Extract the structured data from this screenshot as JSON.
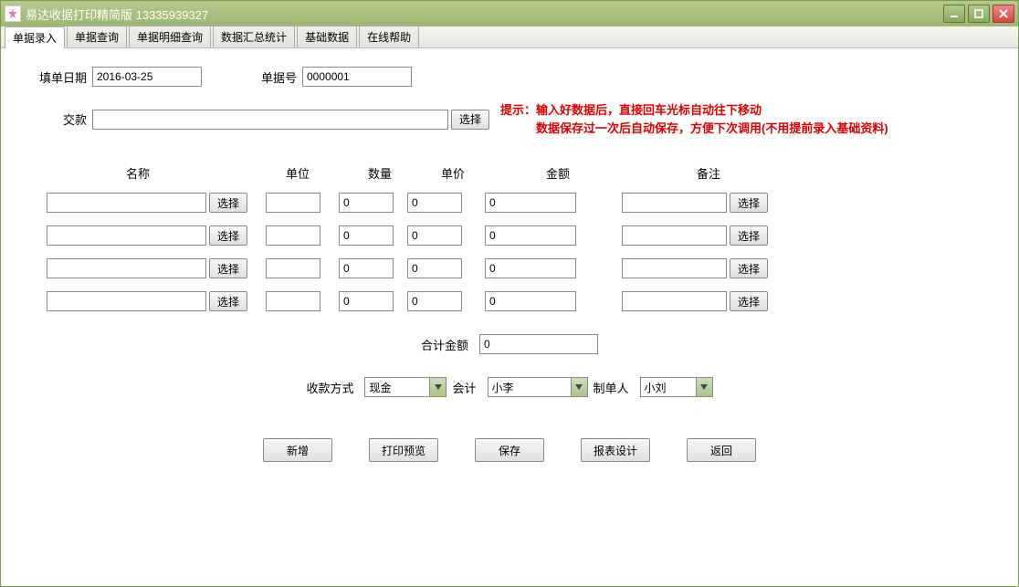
{
  "window": {
    "title": "易达收据打印精简版  13335939327"
  },
  "tabs": [
    {
      "label": "单据录入",
      "active": true
    },
    {
      "label": "单据查询",
      "active": false
    },
    {
      "label": "单据明细查询",
      "active": false
    },
    {
      "label": "数据汇总统计",
      "active": false
    },
    {
      "label": "基础数据",
      "active": false
    },
    {
      "label": "在线帮助",
      "active": false
    }
  ],
  "header": {
    "date_label": "填单日期",
    "date_value": "2016-03-25",
    "bill_no_label": "单据号",
    "bill_no_value": "0000001",
    "payer_label": "交款",
    "payer_value": "",
    "select_btn": "选择",
    "hint_prefix": "提示：",
    "hint_line1": "输入好数据后，直接回车光标自动往下移动",
    "hint_line2": "数据保存过一次后自动保存，方便下次调用(不用提前录入基础资料)"
  },
  "columns": {
    "name": "名称",
    "unit": "单位",
    "qty": "数量",
    "price": "单价",
    "amount": "金额",
    "remark": "备注"
  },
  "rows": [
    {
      "name": "",
      "unit": "",
      "qty": "0",
      "price": "0",
      "amount": "0",
      "remark": ""
    },
    {
      "name": "",
      "unit": "",
      "qty": "0",
      "price": "0",
      "amount": "0",
      "remark": ""
    },
    {
      "name": "",
      "unit": "",
      "qty": "0",
      "price": "0",
      "amount": "0",
      "remark": ""
    },
    {
      "name": "",
      "unit": "",
      "qty": "0",
      "price": "0",
      "amount": "0",
      "remark": ""
    }
  ],
  "select_label": "选择",
  "total": {
    "label": "合计金额",
    "value": "0"
  },
  "payment": {
    "method_label": "收款方式",
    "method_value": "现金",
    "accountant_label": "会计",
    "accountant_value": "小李",
    "creator_label": "制单人",
    "creator_value": "小刘"
  },
  "actions": {
    "new": "新增",
    "preview": "打印预览",
    "save": "保存",
    "report": "报表设计",
    "back": "返回"
  }
}
